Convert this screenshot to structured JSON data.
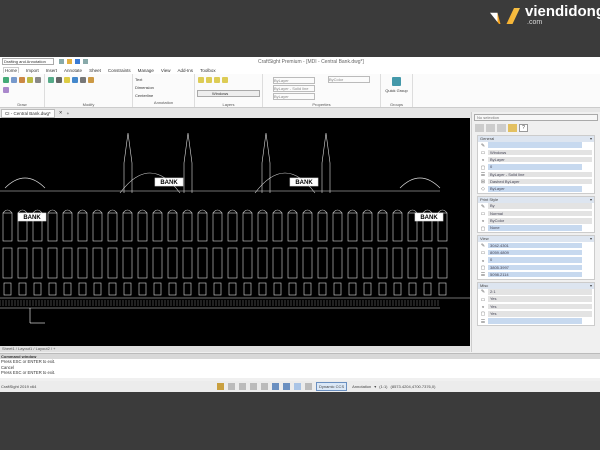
{
  "logo": {
    "name": "viendidong",
    "domain": ".com"
  },
  "window": {
    "title": "CraftSight Premium - [MDI - Central Bank.dwg*]",
    "workspace": "Drafting and Annotation"
  },
  "tabs": [
    "Home",
    "Import",
    "Insert",
    "Annotate",
    "Sheet",
    "Constraints",
    "Manage",
    "View",
    "Add-Ins",
    "Toolbox"
  ],
  "ribbon": {
    "groups": [
      "Draw",
      "Modify",
      "Annotation",
      "Layers",
      "Properties",
      "Groups"
    ],
    "annotation_items": [
      "Text",
      "Dimension",
      "Centerline"
    ],
    "layer_value": "Windows",
    "prop_values": [
      "ByLayer",
      "ByLayer - Solid line",
      "ByLayer",
      "ByColor"
    ],
    "quick_group": "Quick Group"
  },
  "document_tab": "CI - Central Bank.dwg*",
  "panel": {
    "selection": "No selection",
    "sections": [
      {
        "title": "General",
        "rows": [
          "",
          "Windows",
          "ByLayer",
          "0",
          "ByLayer - Solid line",
          "Dashed ByLayer",
          "ByLayer"
        ]
      },
      {
        "title": "Print Style",
        "rows": [
          "By",
          "Normal",
          "ByColor",
          "None"
        ]
      },
      {
        "title": "View",
        "rows": [
          "3042.4301",
          "8059.4809",
          "0",
          "3805.3997",
          "5098.2114"
        ]
      },
      {
        "title": "Misc",
        "rows": [
          "2:1",
          "Yes",
          "Yes",
          "Yes",
          ""
        ]
      }
    ]
  },
  "layout_tabs": "Sheet1 / Layout1 / Layout2 / +",
  "command": {
    "header": "Command window",
    "lines": [
      "Press ESC or ENTER to exit.",
      "Cancel",
      "Press ESC or ENTER to exit."
    ]
  },
  "status": {
    "app": "CraftSight 2019 x64",
    "ccs": "Dynamic CCS",
    "annotation": "Annotation",
    "scale": "(1:1)",
    "coords": "(8573.4204,4700.7376,0)"
  },
  "colors": {
    "accent": "#c7d9ef"
  }
}
